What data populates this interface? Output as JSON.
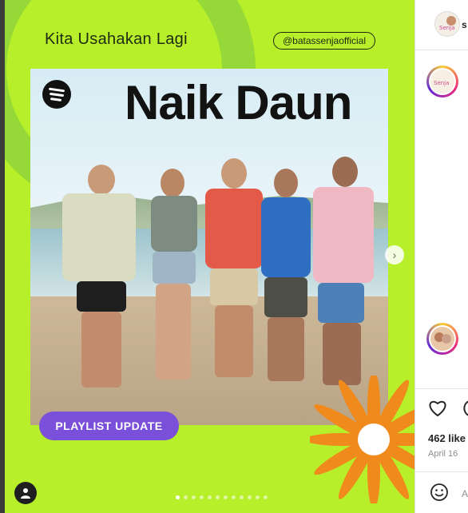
{
  "post": {
    "title": "Kita Usahakan Lagi",
    "handle": "@batassenjaofficial",
    "cover_title": "Naik Daun",
    "badge": "PLAYLIST UPDATE",
    "carousel_dots": 12,
    "active_dot": 0
  },
  "side": {
    "avatar_label": "Senja",
    "cut_letter": "s",
    "likes": "462 like",
    "date": "April 16",
    "comment_placeholder": "A"
  },
  "colors": {
    "accent_green": "#b7ef2a",
    "badge_purple": "#7a4fd9",
    "flower_orange": "#f08a1c"
  },
  "icons": [
    "spotify-icon",
    "chevron-right-icon",
    "user-icon",
    "heart-icon",
    "comment-icon",
    "emoji-icon"
  ]
}
